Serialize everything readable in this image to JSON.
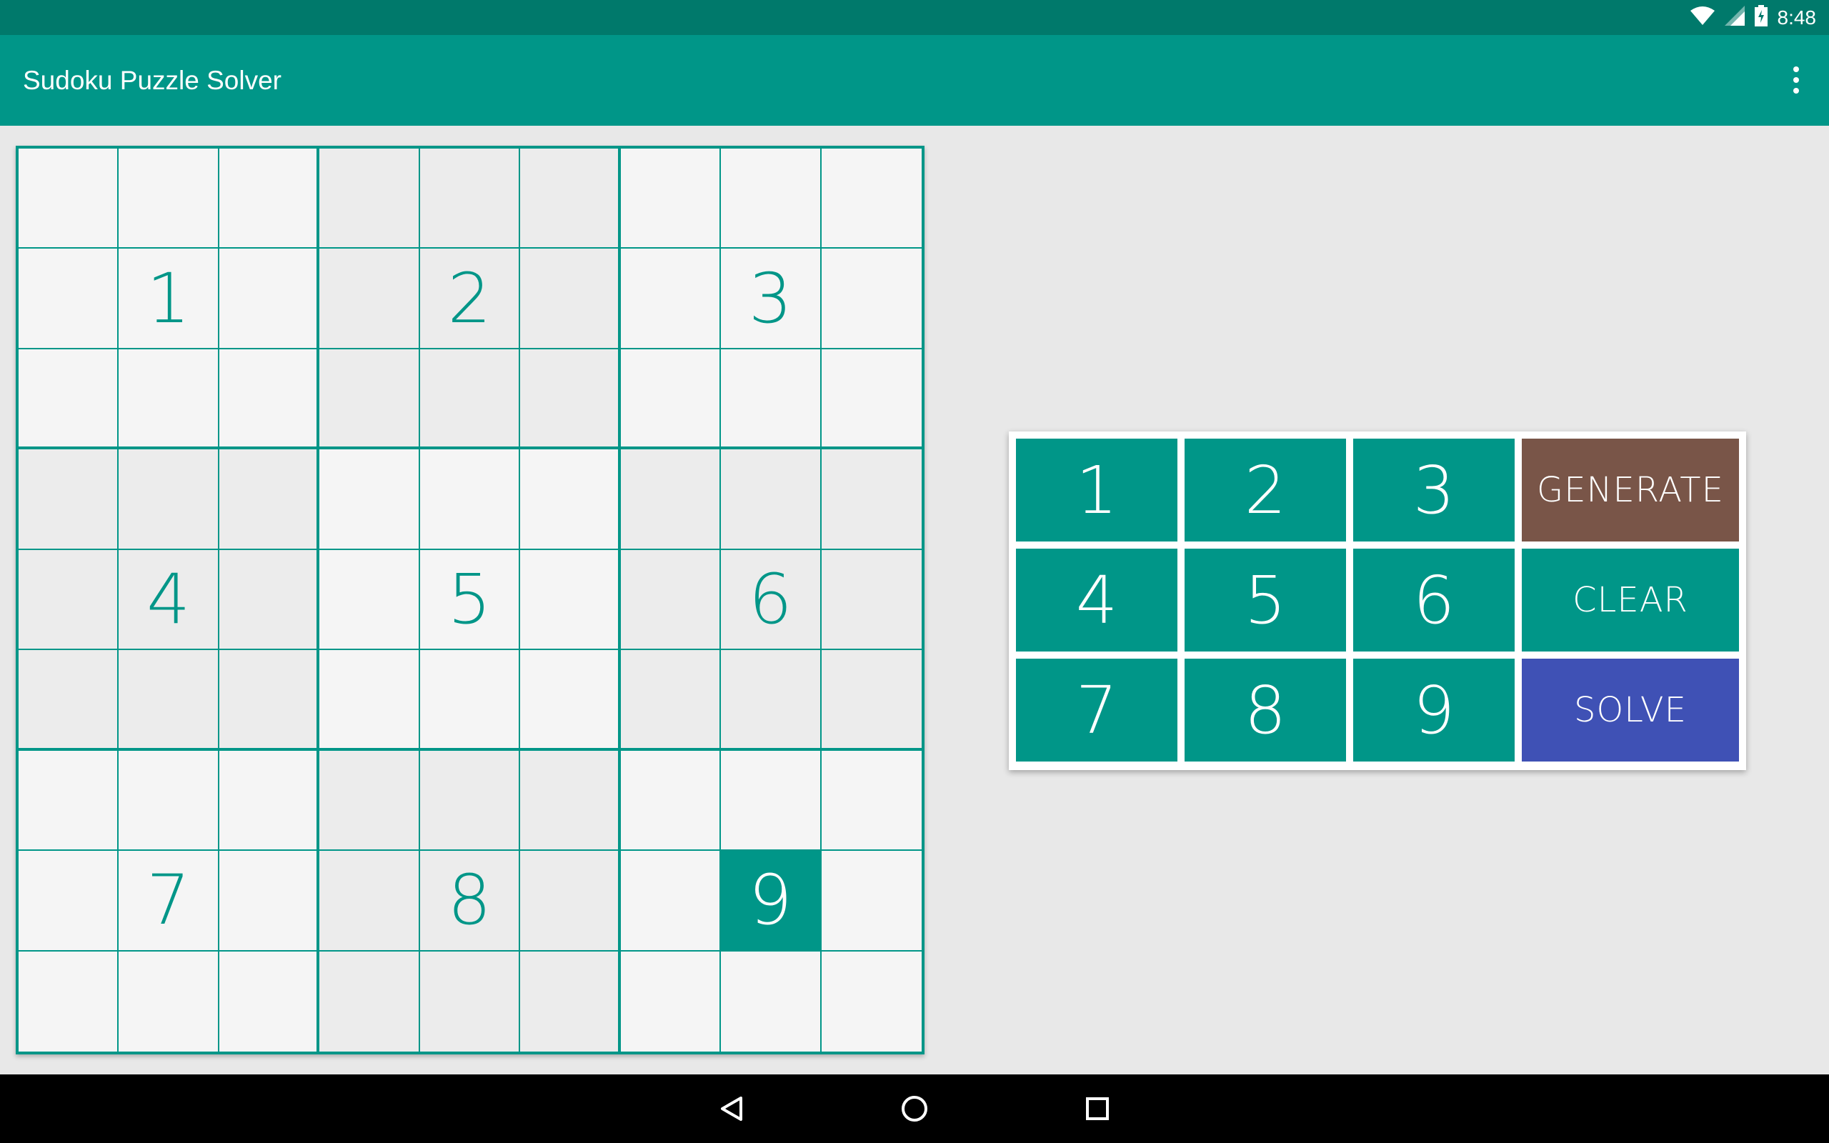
{
  "status_bar": {
    "time": "8:48",
    "icons": [
      "wifi-icon",
      "signal-icon",
      "battery-charging-icon"
    ]
  },
  "app_bar": {
    "title": "Sudoku Puzzle Solver",
    "menu_icon": "overflow-menu-icon"
  },
  "board": {
    "cells": [
      [
        "",
        "",
        "",
        "",
        "",
        "",
        "",
        "",
        ""
      ],
      [
        "",
        "1",
        "",
        "",
        "2",
        "",
        "",
        "3",
        ""
      ],
      [
        "",
        "",
        "",
        "",
        "",
        "",
        "",
        "",
        ""
      ],
      [
        "",
        "",
        "",
        "",
        "",
        "",
        "",
        "",
        ""
      ],
      [
        "",
        "4",
        "",
        "",
        "5",
        "",
        "",
        "6",
        ""
      ],
      [
        "",
        "",
        "",
        "",
        "",
        "",
        "",
        "",
        ""
      ],
      [
        "",
        "",
        "",
        "",
        "",
        "",
        "",
        "",
        ""
      ],
      [
        "",
        "7",
        "",
        "",
        "8",
        "",
        "",
        "9",
        ""
      ],
      [
        "",
        "",
        "",
        "",
        "",
        "",
        "",
        "",
        ""
      ]
    ],
    "selected_cell": {
      "row": 7,
      "col": 7
    }
  },
  "keypad": {
    "numbers": [
      "1",
      "2",
      "3",
      "4",
      "5",
      "6",
      "7",
      "8",
      "9"
    ],
    "generate_label": "GENERATE",
    "clear_label": "CLEAR",
    "solve_label": "SOLVE"
  },
  "colors": {
    "primary": "#009688",
    "primary_dark": "#00796b",
    "generate": "#795548",
    "solve": "#3f51b5",
    "background": "#e8e8e8"
  },
  "nav_bar": {
    "icons": [
      "back-icon",
      "home-icon",
      "recents-icon"
    ]
  }
}
